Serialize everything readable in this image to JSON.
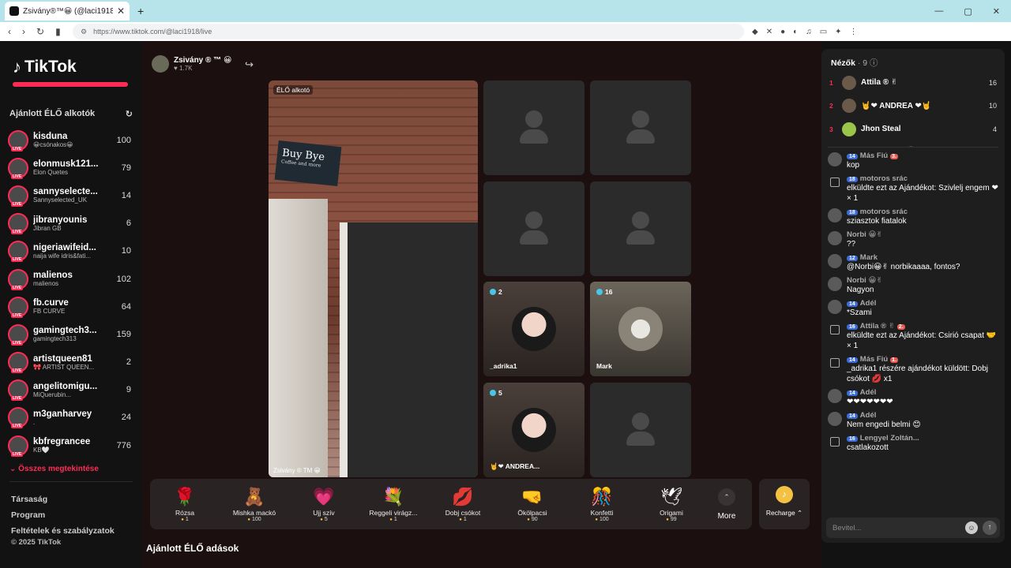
{
  "browser": {
    "tab_title": "Zsivány®™😀 (@laci1918) ÉL...",
    "tab_close": "✕",
    "new_tab": "+",
    "url": "https://www.tiktok.com/@laci1918/live",
    "window_controls": [
      "—",
      "▢",
      "✕"
    ],
    "nav": [
      "‹",
      "›",
      "↻",
      "▮"
    ]
  },
  "sidebar": {
    "brand": "TikTok",
    "section_title": "Ajánlott ÉLŐ alkotók",
    "refresh_icon": "↻",
    "creators": [
      {
        "name": "kisduna",
        "sub": "😀csónakos😀",
        "count": "100"
      },
      {
        "name": "elonmusk121...",
        "sub": "Elon Quetes",
        "count": "79"
      },
      {
        "name": "sannyselecte...",
        "sub": "Sannyselected_UK",
        "count": "14"
      },
      {
        "name": "jibranyounis",
        "sub": "Jibran GB",
        "count": "6"
      },
      {
        "name": "nigeriawifeid...",
        "sub": "naija wife idris&fati...",
        "count": "10"
      },
      {
        "name": "malienos",
        "sub": "malienos",
        "count": "102"
      },
      {
        "name": "fb.curve",
        "sub": "FB CURVE",
        "count": "64"
      },
      {
        "name": "gamingtech3...",
        "sub": "gamingtech313",
        "count": "159"
      },
      {
        "name": "artistqueen81",
        "sub": "🎀 ARTIST QUEEN...",
        "count": "2"
      },
      {
        "name": "angelitomigu...",
        "sub": "MiQuerubin...",
        "count": "9"
      },
      {
        "name": "m3ganharvey",
        "sub": ".",
        "count": "24"
      },
      {
        "name": "kbfregrancee",
        "sub": "KB🤍",
        "count": "776"
      }
    ],
    "show_all": "Összes megtekintése",
    "footer_links": [
      "Társaság",
      "Program",
      "Feltételek és szabályzatok"
    ],
    "copyright": "© 2025 TikTok"
  },
  "stream": {
    "host_name": "Zsivány ® ™ 😀",
    "host_likes": "♥ 1.7K",
    "share_icon": "↪",
    "stage_label": "ÉLŐ alkotó",
    "stage_name": "Zsivány ® TM 😀",
    "sign_text": "Buy Bye",
    "sign_sub": "Coffee and more",
    "guests": [
      {
        "badge": "2",
        "name": "_adrika1"
      },
      {
        "badge": "16",
        "name": "Mark"
      },
      {
        "badge": "5",
        "name": "🤘❤ ANDREA..."
      }
    ],
    "gifts": [
      {
        "icon": "🌹",
        "title": "Rózsa",
        "price": "1"
      },
      {
        "icon": "🧸",
        "title": "Mishka mackó",
        "price": "100"
      },
      {
        "icon": "💗",
        "title": "Ujj szív",
        "price": "5"
      },
      {
        "icon": "💐",
        "title": "Reggeli virágz...",
        "price": "1"
      },
      {
        "icon": "💋",
        "title": "Dobj csókot",
        "price": "1"
      },
      {
        "icon": "🤜",
        "title": "Ökölpacsi",
        "price": "90"
      },
      {
        "icon": "🎊",
        "title": "Konfetti",
        "price": "100"
      },
      {
        "icon": "🕊",
        "title": "Origami",
        "price": "99"
      }
    ],
    "more_label": "More",
    "more_icon": "⌃",
    "recharge_label": "Recharge ⌃",
    "recharge_icon": "♪",
    "recommended_title": "Ajánlott ÉLŐ adások"
  },
  "viewers": {
    "title": "Nézők",
    "count": "· 9",
    "info_icon": "ⓘ",
    "list": [
      {
        "rank": "1",
        "name": "Attila ® ✌",
        "count": "16"
      },
      {
        "rank": "2",
        "name": "🤘❤ ANDREA ❤🤘",
        "count": "10"
      },
      {
        "rank": "3",
        "name": "Jhon Steal",
        "count": "4"
      }
    ],
    "expand_icon": "⌄"
  },
  "chat": {
    "messages": [
      {
        "lvl": "14",
        "user": "Más Fiú",
        "fan": "3.",
        "text": "kop",
        "gift": false
      },
      {
        "lvl": "18",
        "user": "motoros srác",
        "fan": "",
        "text": "elküldte ezt az Ajándékot: Szivlelj engem ❤ × 1",
        "gift": true
      },
      {
        "lvl": "18",
        "user": "motoros srác",
        "fan": "",
        "text": "sziasztok fiatalok",
        "gift": false
      },
      {
        "lvl": "",
        "user": "Norbi 😀✌",
        "fan": "",
        "text": "??",
        "gift": false
      },
      {
        "lvl": "12",
        "user": "Mark",
        "fan": "",
        "text": "@Norbi😀✌ norbikaaaa, fontos?",
        "gift": false
      },
      {
        "lvl": "",
        "user": "Norbi 😀✌",
        "fan": "",
        "text": "Nagyon",
        "gift": false
      },
      {
        "lvl": "14",
        "user": "Adél",
        "fan": "",
        "text": "*Szami",
        "gift": false
      },
      {
        "lvl": "16",
        "user": "Attila ® ✌",
        "fan": "2.",
        "text": "elküldte ezt az Ajándékot: Csirió csapat 🤝 × 1",
        "gift": true
      },
      {
        "lvl": "14",
        "user": "Más Fiú",
        "fan": "1.",
        "text": "_adrika1 részére ajándékot küldött: Dobj csókot 💋 x1",
        "gift": true
      },
      {
        "lvl": "14",
        "user": "Adél",
        "fan": "",
        "text": "❤❤❤❤❤❤❤",
        "gift": false
      },
      {
        "lvl": "14",
        "user": "Adél",
        "fan": "",
        "text": "Nem engedi belmi 😊",
        "gift": false
      },
      {
        "lvl": "16",
        "user": "Lengyel Zoltán...",
        "fan": "",
        "text": "csatlakozott",
        "gift": true
      }
    ],
    "input_placeholder": "Bevitel...",
    "emoji_icon": "☺",
    "send_icon": "↑"
  }
}
